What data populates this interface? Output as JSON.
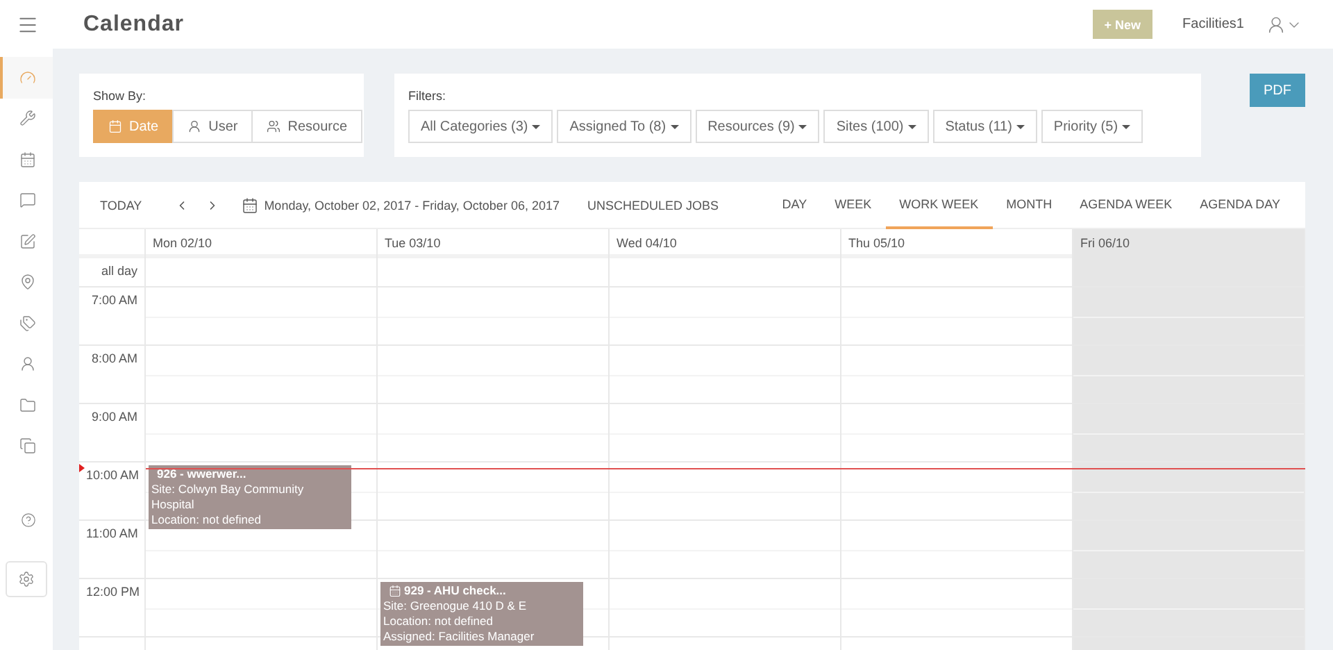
{
  "topbar": {
    "title": "Calendar",
    "new_button": "+ New",
    "user": "Facilities1"
  },
  "sidebar": {
    "items": [
      {
        "selected": true
      },
      {
        "selected": false
      },
      {
        "selected": false
      },
      {
        "selected": false
      },
      {
        "selected": false
      },
      {
        "selected": false
      },
      {
        "selected": false
      },
      {
        "selected": false
      },
      {
        "selected": false
      },
      {
        "selected": false
      }
    ]
  },
  "show_by": {
    "label": "Show By:",
    "options": [
      {
        "label": "Date",
        "selected": true
      },
      {
        "label": "User",
        "selected": false
      },
      {
        "label": "Resource",
        "selected": false
      }
    ]
  },
  "filters": {
    "label": "Filters:",
    "dropdowns": [
      "All Categories (3)",
      "Assigned To (8)",
      "Resources (9)",
      "Sites (100)",
      "Status (11)",
      "Priority (5)"
    ]
  },
  "pdf_button": "PDF",
  "calendar": {
    "today": "TODAY",
    "range": "Monday, October 02, 2017 - Friday, October 06, 2017",
    "unscheduled": "UNSCHEDULED JOBS",
    "views": [
      {
        "label": "DAY",
        "selected": false
      },
      {
        "label": "WEEK",
        "selected": false
      },
      {
        "label": "WORK WEEK",
        "selected": true
      },
      {
        "label": "MONTH",
        "selected": false
      },
      {
        "label": "AGENDA WEEK",
        "selected": false
      },
      {
        "label": "AGENDA DAY",
        "selected": false
      }
    ],
    "all_day": "all day",
    "days": [
      {
        "label": "Mon 02/10",
        "disabled": false
      },
      {
        "label": "Tue 03/10",
        "disabled": false
      },
      {
        "label": "Wed 04/10",
        "disabled": false
      },
      {
        "label": "Thu 05/10",
        "disabled": false
      },
      {
        "label": "Fri 06/10",
        "disabled": true
      }
    ],
    "hours": [
      {
        "label": "7:00 AM"
      },
      {
        "label": "8:00 AM"
      },
      {
        "label": "9:00 AM"
      },
      {
        "label": "10:00 AM",
        "cells": [
          {
            "kind": "plain",
            "title": "926 - wwerwer...",
            "lines": [
              "Site: Colwyn Bay Community Hospital",
              "Location: not defined"
            ]
          },
          null,
          null,
          null,
          null
        ]
      },
      {
        "label": "11:00 AM"
      },
      {
        "label": "12:00 PM",
        "cells": [
          null,
          {
            "kind": "calendar",
            "title": "929 - AHU check...",
            "lines": [
              "Site: Greenogue 410 D & E",
              "Location: not defined",
              "Assigned: Facilities Manager"
            ]
          },
          null,
          null,
          null
        ]
      }
    ]
  }
}
